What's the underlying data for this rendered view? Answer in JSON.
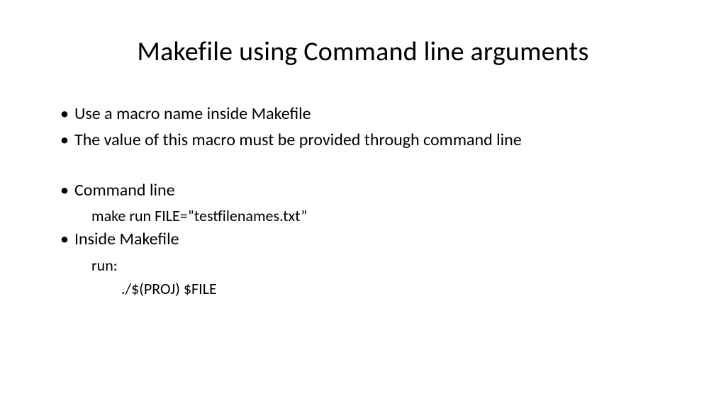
{
  "title": "Makefile using Command line arguments",
  "bullets": {
    "b1": "Use a macro name inside Makefile",
    "b2": "The value of this macro must be provided through command line",
    "b3": "Command line",
    "b3_sub": "make run FILE=”testfilenames.txt”",
    "b4": "Inside Makefile",
    "b4_sub1": "run:",
    "b4_sub2": "./$(PROJ) $FILE"
  }
}
